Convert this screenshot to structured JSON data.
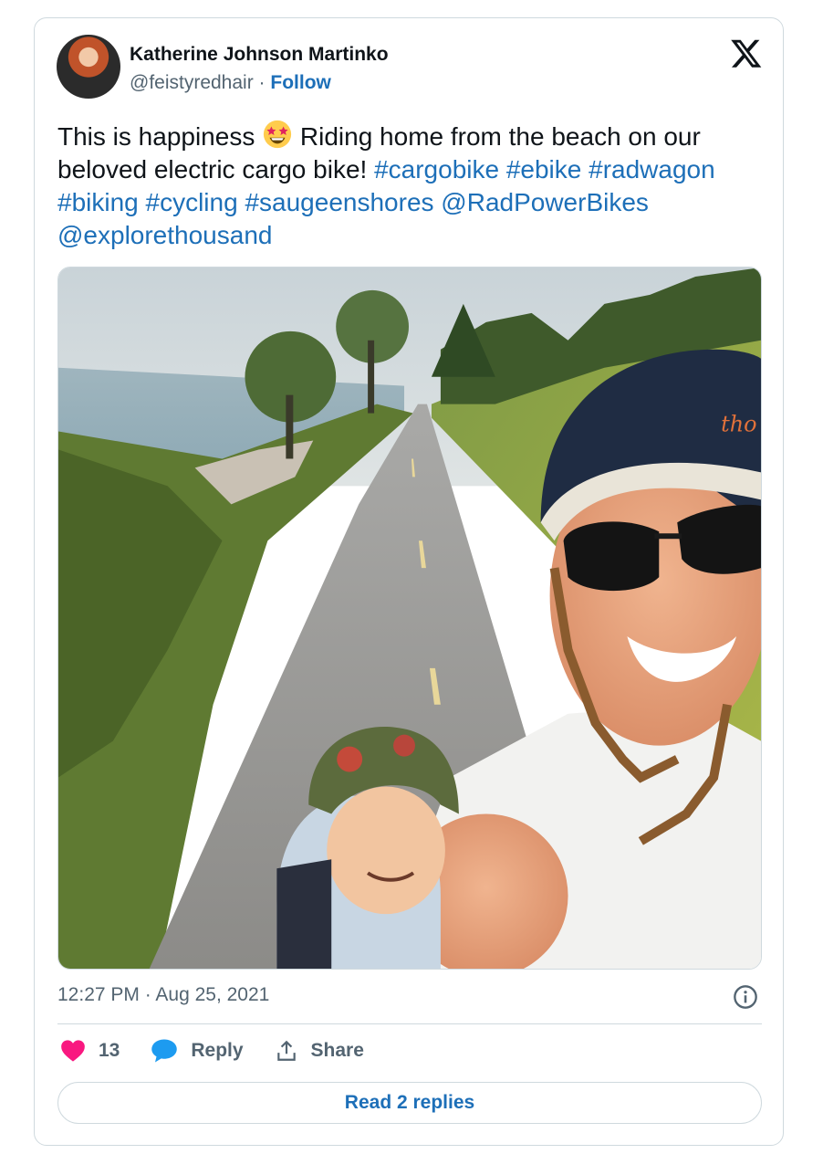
{
  "author": {
    "name": "Katherine Johnson Martinko",
    "handle": "@feistyredhair",
    "separator": "·",
    "follow_label": "Follow"
  },
  "tweet": {
    "text_part1": "This is happiness ",
    "emoji_icon": "star-struck-emoji-icon",
    "text_part2": " Riding home from the beach on our beloved electric cargo bike! ",
    "hashtags": [
      "#cargobike",
      "#ebike",
      "#radwagon",
      "#biking",
      "#cycling",
      "#saugeenshores"
    ],
    "mentions": [
      "@RadPowerBikes",
      "@explorethousand"
    ]
  },
  "photo": {
    "icon": "photo-of-woman-and-child-on-cargo-bike"
  },
  "meta": {
    "timestamp": "12:27 PM · Aug 25, 2021"
  },
  "actions": {
    "like_count": "13",
    "reply_label": "Reply",
    "share_label": "Share"
  },
  "read_replies_label": "Read 2 replies",
  "colors": {
    "link": "#1d6fb8",
    "like": "#f91880",
    "reply": "#1d9bf0",
    "muted": "#536471",
    "border": "#cfd9de"
  }
}
